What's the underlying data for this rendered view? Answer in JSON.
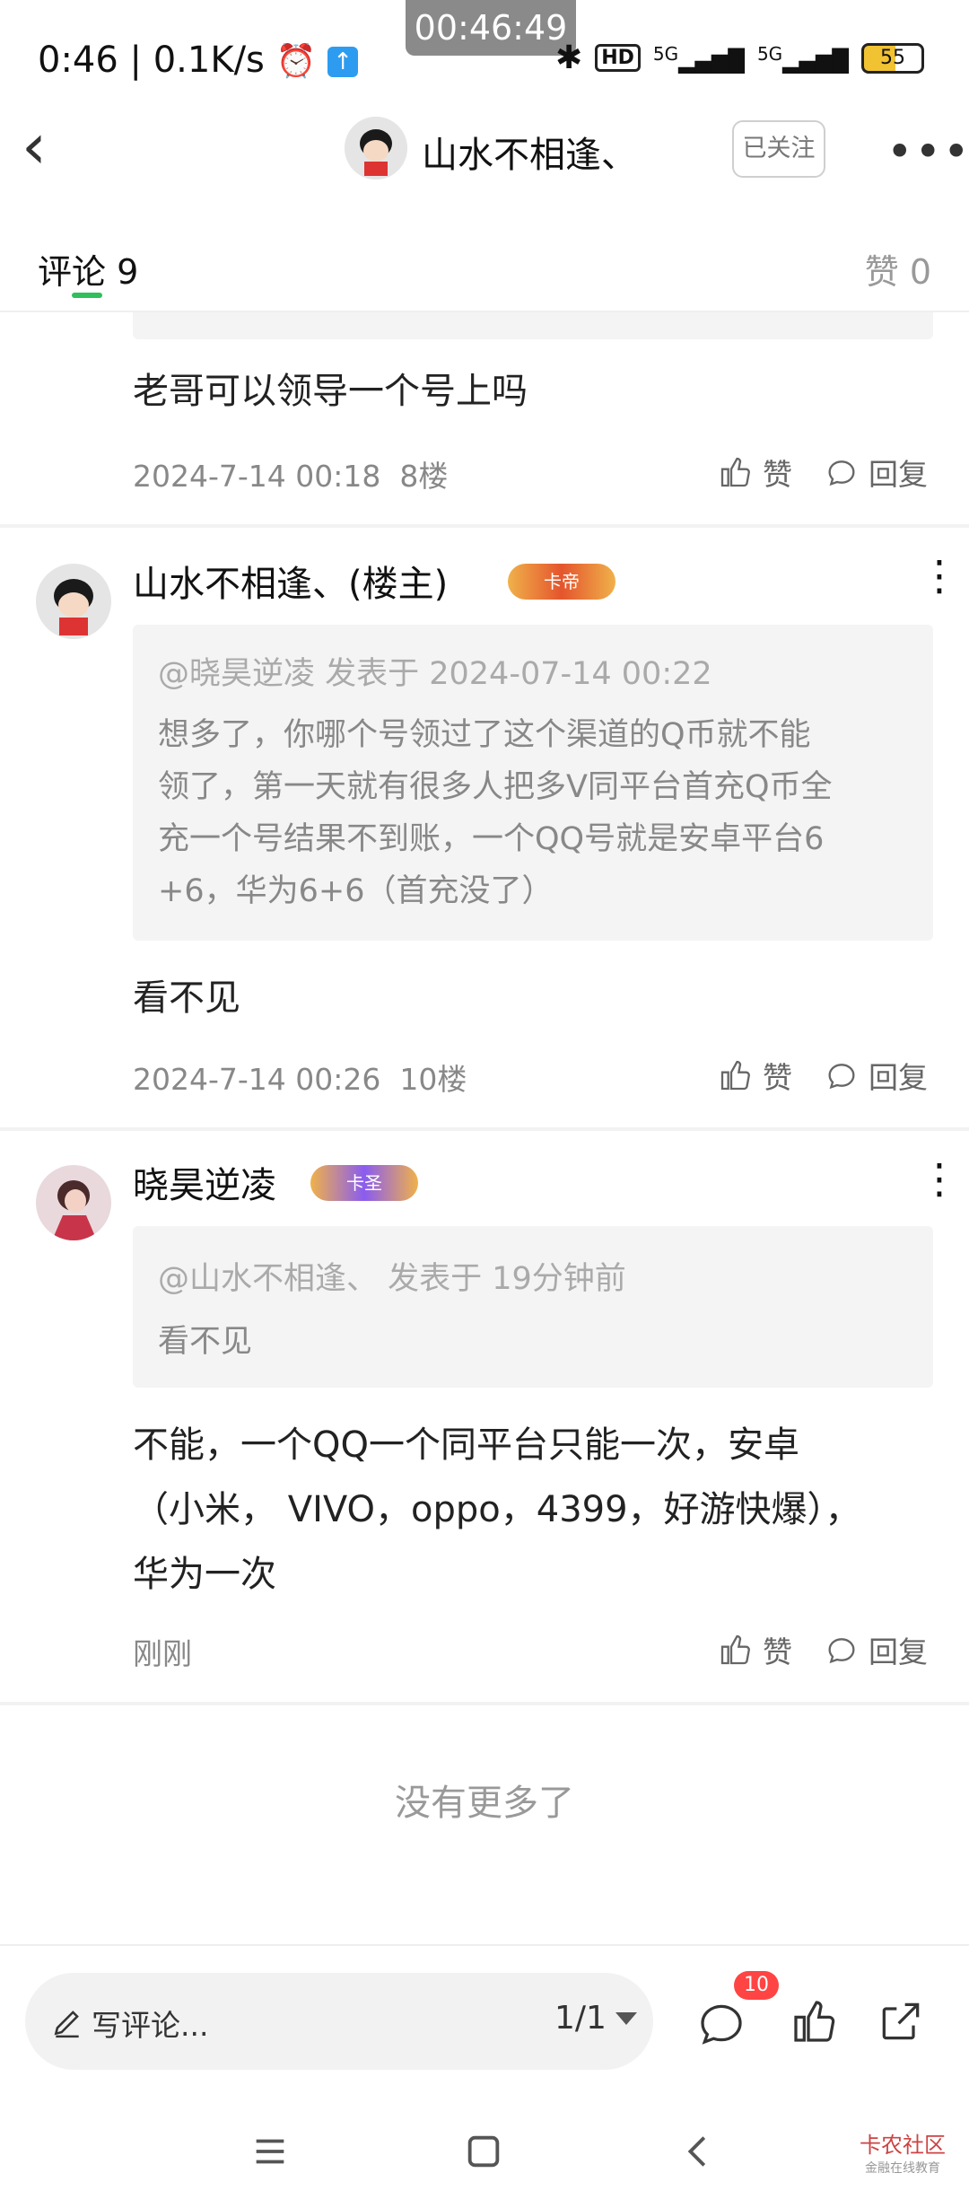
{
  "status_bar": {
    "time": "0:46",
    "speed": "0.1K/s",
    "timer": "00:46:49",
    "net1": "5G",
    "net2": "5G",
    "battery": "55",
    "hd": "HD"
  },
  "header": {
    "username": "山水不相逢、",
    "follow_label": "已关注"
  },
  "tabs": {
    "comments_label": "评论",
    "comments_count": "9",
    "likes_label": "赞",
    "likes_count": "0"
  },
  "comments": [
    {
      "text": "老哥可以领导一个号上吗",
      "date": "2024-7-14 00:18",
      "floor": "8楼",
      "like_label": "赞",
      "reply_label": "回复"
    },
    {
      "name": "山水不相逢、(楼主)",
      "badge": "卡帝",
      "quote_head": "@晓昊逆凌 发表于 2024-07-14 00:22",
      "quote_lines": [
        "想多了，你哪个号领过了这个渠道的Q币就不能",
        "领了，第一天就有很多人把多V同平台首充Q币全",
        "充一个号结果不到账，一个QQ号就是安卓平台6",
        "+6，华为6+6（首充没了）"
      ],
      "text": "看不见",
      "date": "2024-7-14 00:26",
      "floor": "10楼",
      "like_label": "赞",
      "reply_label": "回复"
    },
    {
      "name": "晓昊逆凌",
      "badge": "卡圣",
      "quote_head": "@山水不相逢、 发表于 19分钟前",
      "quote_text": "看不见",
      "text_lines": [
        "不能，一个QQ一个同平台只能一次，安卓",
        "（小米， VIVO，oppo，4399，好游快爆），",
        "华为一次"
      ],
      "date": "刚刚",
      "like_label": "赞",
      "reply_label": "回复"
    }
  ],
  "no_more": "没有更多了",
  "bottom_bar": {
    "write_placeholder": "写评论...",
    "page_indicator": "1/1",
    "message_count": "10"
  },
  "watermark": {
    "title": "卡农社区",
    "subtitle": "金融在线教育"
  },
  "colors": {
    "accent_green": "#2fbf5b",
    "badge_gold": "#e8a13a",
    "badge_purple": "#8a5cf0",
    "badge_red": "#f44444"
  }
}
